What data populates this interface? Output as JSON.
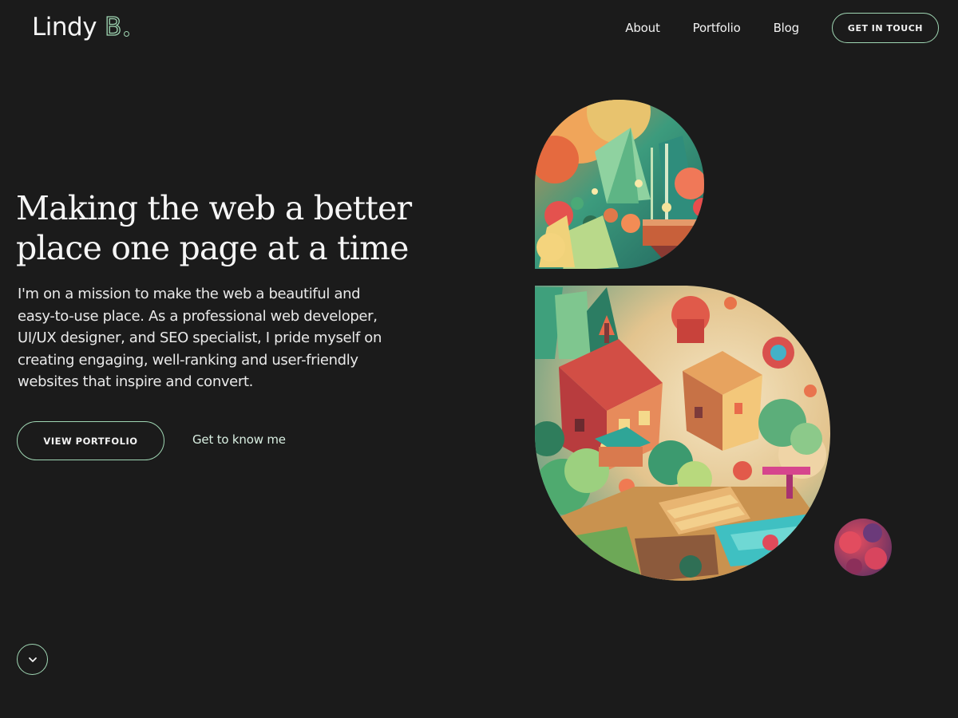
{
  "brand": {
    "name": "Lindy",
    "mark": "B"
  },
  "nav": {
    "items": [
      {
        "label": "About"
      },
      {
        "label": "Portfolio"
      },
      {
        "label": "Blog"
      }
    ],
    "cta_label": "GET IN TOUCH"
  },
  "hero": {
    "title_lines": [
      "Making the web a better",
      "place one page at a time"
    ],
    "body_lines": [
      "I'm on a mission to make the web a beautiful and",
      "easy-to-use place. As a professional web developer,",
      "UI/UX designer, and SEO specialist, I pride myself on",
      "creating engaging, well-ranking and user-friendly",
      "websites that inspire and convert."
    ],
    "primary_button_label": "VIEW PORTFOLIO",
    "secondary_link_label": "Get to know me"
  },
  "scroll_indicator": {
    "icon": "chevron-down-icon"
  },
  "illustration": {
    "icon": "brand-b-illustration",
    "style": "colorful low-poly fantasy village"
  },
  "colors": {
    "background": "#1b1b1b",
    "accent": "#9fd6b3",
    "text": "#f2f2f2"
  }
}
